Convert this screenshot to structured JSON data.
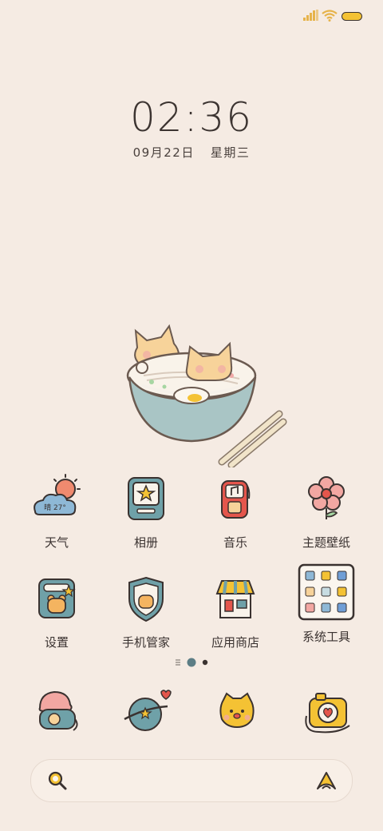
{
  "clock": {
    "time": "02:36",
    "date": "09月22日",
    "weekday": "星期三"
  },
  "apps": [
    {
      "label": "天气",
      "weather_text": "晴 27°"
    },
    {
      "label": "相册"
    },
    {
      "label": "音乐"
    },
    {
      "label": "主题壁纸"
    },
    {
      "label": "设置"
    },
    {
      "label": "手机管家"
    },
    {
      "label": "应用商店"
    },
    {
      "label": "系统工具"
    }
  ],
  "colors": {
    "background": "#f5ebe3",
    "battery": "#f4c234",
    "accent_teal": "#6fa1a8",
    "accent_yellow": "#f4c234"
  },
  "icons": {
    "dock": [
      "phone-icon",
      "browser-icon",
      "messages-icon",
      "camera-icon"
    ],
    "search": "search-icon",
    "assistant": "assistant-icon"
  }
}
